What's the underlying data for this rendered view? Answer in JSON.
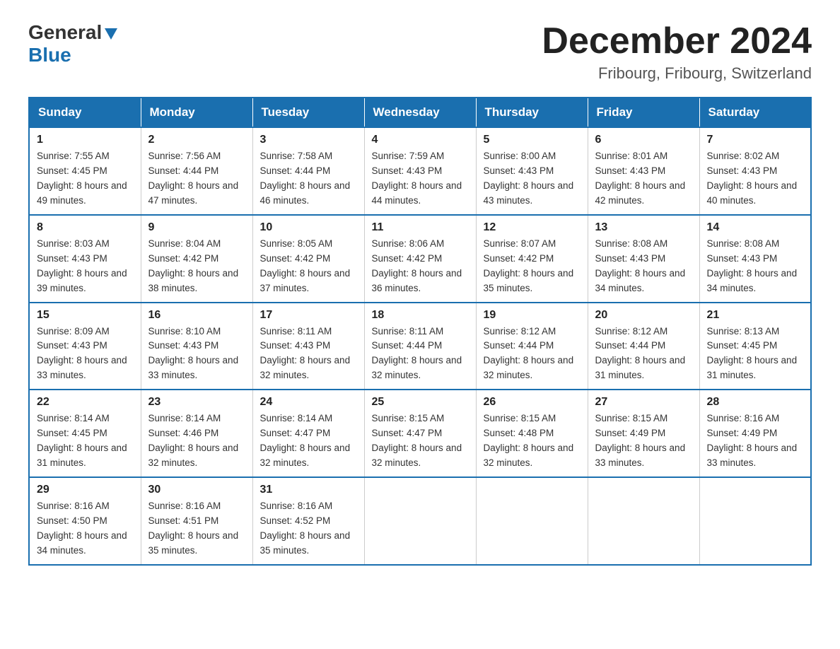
{
  "logo": {
    "general": "General",
    "blue": "Blue"
  },
  "title": "December 2024",
  "location": "Fribourg, Fribourg, Switzerland",
  "weekdays": [
    "Sunday",
    "Monday",
    "Tuesday",
    "Wednesday",
    "Thursday",
    "Friday",
    "Saturday"
  ],
  "weeks": [
    [
      {
        "day": "1",
        "sunrise": "7:55 AM",
        "sunset": "4:45 PM",
        "daylight": "8 hours and 49 minutes."
      },
      {
        "day": "2",
        "sunrise": "7:56 AM",
        "sunset": "4:44 PM",
        "daylight": "8 hours and 47 minutes."
      },
      {
        "day": "3",
        "sunrise": "7:58 AM",
        "sunset": "4:44 PM",
        "daylight": "8 hours and 46 minutes."
      },
      {
        "day": "4",
        "sunrise": "7:59 AM",
        "sunset": "4:43 PM",
        "daylight": "8 hours and 44 minutes."
      },
      {
        "day": "5",
        "sunrise": "8:00 AM",
        "sunset": "4:43 PM",
        "daylight": "8 hours and 43 minutes."
      },
      {
        "day": "6",
        "sunrise": "8:01 AM",
        "sunset": "4:43 PM",
        "daylight": "8 hours and 42 minutes."
      },
      {
        "day": "7",
        "sunrise": "8:02 AM",
        "sunset": "4:43 PM",
        "daylight": "8 hours and 40 minutes."
      }
    ],
    [
      {
        "day": "8",
        "sunrise": "8:03 AM",
        "sunset": "4:43 PM",
        "daylight": "8 hours and 39 minutes."
      },
      {
        "day": "9",
        "sunrise": "8:04 AM",
        "sunset": "4:42 PM",
        "daylight": "8 hours and 38 minutes."
      },
      {
        "day": "10",
        "sunrise": "8:05 AM",
        "sunset": "4:42 PM",
        "daylight": "8 hours and 37 minutes."
      },
      {
        "day": "11",
        "sunrise": "8:06 AM",
        "sunset": "4:42 PM",
        "daylight": "8 hours and 36 minutes."
      },
      {
        "day": "12",
        "sunrise": "8:07 AM",
        "sunset": "4:42 PM",
        "daylight": "8 hours and 35 minutes."
      },
      {
        "day": "13",
        "sunrise": "8:08 AM",
        "sunset": "4:43 PM",
        "daylight": "8 hours and 34 minutes."
      },
      {
        "day": "14",
        "sunrise": "8:08 AM",
        "sunset": "4:43 PM",
        "daylight": "8 hours and 34 minutes."
      }
    ],
    [
      {
        "day": "15",
        "sunrise": "8:09 AM",
        "sunset": "4:43 PM",
        "daylight": "8 hours and 33 minutes."
      },
      {
        "day": "16",
        "sunrise": "8:10 AM",
        "sunset": "4:43 PM",
        "daylight": "8 hours and 33 minutes."
      },
      {
        "day": "17",
        "sunrise": "8:11 AM",
        "sunset": "4:43 PM",
        "daylight": "8 hours and 32 minutes."
      },
      {
        "day": "18",
        "sunrise": "8:11 AM",
        "sunset": "4:44 PM",
        "daylight": "8 hours and 32 minutes."
      },
      {
        "day": "19",
        "sunrise": "8:12 AM",
        "sunset": "4:44 PM",
        "daylight": "8 hours and 32 minutes."
      },
      {
        "day": "20",
        "sunrise": "8:12 AM",
        "sunset": "4:44 PM",
        "daylight": "8 hours and 31 minutes."
      },
      {
        "day": "21",
        "sunrise": "8:13 AM",
        "sunset": "4:45 PM",
        "daylight": "8 hours and 31 minutes."
      }
    ],
    [
      {
        "day": "22",
        "sunrise": "8:14 AM",
        "sunset": "4:45 PM",
        "daylight": "8 hours and 31 minutes."
      },
      {
        "day": "23",
        "sunrise": "8:14 AM",
        "sunset": "4:46 PM",
        "daylight": "8 hours and 32 minutes."
      },
      {
        "day": "24",
        "sunrise": "8:14 AM",
        "sunset": "4:47 PM",
        "daylight": "8 hours and 32 minutes."
      },
      {
        "day": "25",
        "sunrise": "8:15 AM",
        "sunset": "4:47 PM",
        "daylight": "8 hours and 32 minutes."
      },
      {
        "day": "26",
        "sunrise": "8:15 AM",
        "sunset": "4:48 PM",
        "daylight": "8 hours and 32 minutes."
      },
      {
        "day": "27",
        "sunrise": "8:15 AM",
        "sunset": "4:49 PM",
        "daylight": "8 hours and 33 minutes."
      },
      {
        "day": "28",
        "sunrise": "8:16 AM",
        "sunset": "4:49 PM",
        "daylight": "8 hours and 33 minutes."
      }
    ],
    [
      {
        "day": "29",
        "sunrise": "8:16 AM",
        "sunset": "4:50 PM",
        "daylight": "8 hours and 34 minutes."
      },
      {
        "day": "30",
        "sunrise": "8:16 AM",
        "sunset": "4:51 PM",
        "daylight": "8 hours and 35 minutes."
      },
      {
        "day": "31",
        "sunrise": "8:16 AM",
        "sunset": "4:52 PM",
        "daylight": "8 hours and 35 minutes."
      },
      null,
      null,
      null,
      null
    ]
  ]
}
